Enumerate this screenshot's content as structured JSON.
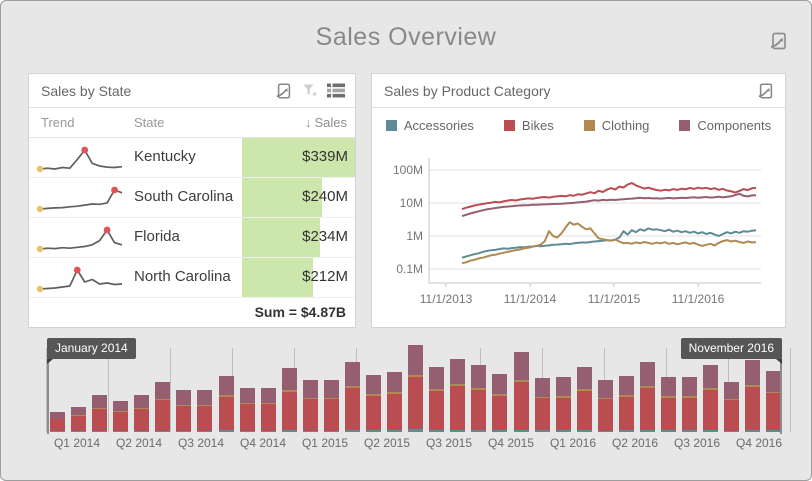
{
  "title": "Sales Overview",
  "panels": {
    "sales_by_state": {
      "title": "Sales by State",
      "columns": {
        "trend": "Trend",
        "state": "State",
        "sales": "Sales"
      },
      "sort_indicator": "↓",
      "rows": [
        {
          "state": "Kentucky",
          "sales": "$339M",
          "bar_pct": 100,
          "trend": [
            3,
            3.2,
            3,
            3.4,
            3.2,
            5.5,
            8,
            4.5,
            3.8,
            3.5,
            3.4,
            3.6
          ]
        },
        {
          "state": "South Carolina",
          "sales": "$240M",
          "bar_pct": 71,
          "trend": [
            2,
            2.1,
            2.2,
            2.25,
            2.4,
            2.5,
            2.7,
            2.9,
            2.85,
            3.1,
            5.4,
            4.9
          ]
        },
        {
          "state": "Florida",
          "sales": "$234M",
          "bar_pct": 69,
          "trend": [
            2,
            2.2,
            2.1,
            2.3,
            2.2,
            2.4,
            2.6,
            3.0,
            4.0,
            6.5,
            3.5,
            3.0
          ]
        },
        {
          "state": "North Carolina",
          "sales": "$212M",
          "bar_pct": 63,
          "trend": [
            2,
            2.1,
            2.2,
            2.4,
            2.6,
            5.8,
            3.4,
            3.9,
            3.0,
            3.2,
            2.9,
            3.0
          ]
        }
      ],
      "footer": "Sum = $4.87B",
      "sparkline_colors": {
        "line": "#5f5f5f",
        "min_point": "#e8c267",
        "max_point": "#e55253"
      }
    },
    "sales_by_category": {
      "title": "Sales by Product Category"
    }
  },
  "chart_data": [
    {
      "type": "line",
      "title": "Sales by Product Category",
      "y_scale": "log",
      "ylim": [
        100000,
        200000000
      ],
      "ytick_labels": [
        "100M",
        "10M",
        "1M",
        "0.1M"
      ],
      "ytick_values": [
        100,
        10,
        1,
        0.1
      ],
      "xtick_labels": [
        "11/1/2013",
        "11/1/2014",
        "11/1/2015",
        "11/1/2016"
      ],
      "legend_position": "top",
      "grid": true,
      "units": "millions USD, monthly-ish samples Jan 2014 - Dec 2016",
      "series": [
        {
          "name": "Accessories",
          "color": "#5f8b95",
          "values": [
            0.22,
            0.24,
            0.26,
            0.28,
            0.3,
            0.33,
            0.35,
            0.37,
            0.38,
            0.4,
            0.42,
            0.41,
            0.43,
            0.44,
            0.46,
            0.45,
            0.47,
            0.48,
            0.5,
            0.49,
            0.51,
            0.52,
            0.54,
            0.55,
            0.56,
            0.58,
            0.57,
            0.6,
            0.62,
            0.64,
            0.63,
            0.66,
            0.68,
            0.7,
            0.72,
            0.75,
            0.73,
            0.78,
            0.9,
            1.4,
            1.1,
            1.5,
            1.3,
            1.6,
            1.45,
            1.7,
            1.55,
            1.6,
            1.5,
            1.4,
            1.55,
            1.35,
            1.45,
            1.3,
            1.4,
            1.25,
            1.35,
            1.2,
            1.3,
            1.15,
            1.25,
            1.1,
            1.0,
            1.15,
            1.3,
            1.2,
            1.35,
            1.25,
            1.4,
            1.35,
            1.45,
            1.5
          ]
        },
        {
          "name": "Bikes",
          "color": "#ba4d51",
          "values": [
            6.5,
            7.2,
            7.8,
            8.4,
            8.9,
            9.3,
            9.8,
            10.2,
            10.8,
            10.4,
            11.2,
            11.8,
            12.3,
            11.9,
            12.8,
            13.2,
            13.8,
            13.4,
            14.2,
            14.8,
            15.2,
            14.6,
            15.4,
            15.9,
            16.4,
            15.8,
            17.2,
            16.6,
            18.4,
            17.8,
            19.6,
            21.2,
            19.8,
            23.5,
            21.6,
            25.4,
            28.2,
            25.6,
            31.5,
            29.4,
            36.0,
            40.5,
            34.2,
            30.6,
            27.4,
            29.2,
            26.5,
            24.8,
            23.6,
            25.2,
            24.1,
            26.3,
            25.0,
            27.2,
            26.0,
            28.4,
            26.8,
            29.0,
            27.6,
            28.8,
            26.4,
            28.0,
            25.2,
            26.8,
            24.0,
            22.4,
            20.8,
            23.2,
            26.4,
            24.6,
            27.8,
            28.6
          ]
        },
        {
          "name": "Clothing",
          "color": "#af8a53",
          "values": [
            0.15,
            0.16,
            0.18,
            0.19,
            0.21,
            0.22,
            0.24,
            0.26,
            0.27,
            0.29,
            0.31,
            0.33,
            0.35,
            0.37,
            0.39,
            0.42,
            0.44,
            0.47,
            0.5,
            0.55,
            0.7,
            1.4,
            1.0,
            0.9,
            1.2,
            1.8,
            2.6,
            2.2,
            2.4,
            1.9,
            1.6,
            1.7,
            1.2,
            0.85,
            0.8,
            0.75,
            0.72,
            0.78,
            0.68,
            0.6,
            0.62,
            0.58,
            0.64,
            0.6,
            0.66,
            0.62,
            0.58,
            0.63,
            0.6,
            0.65,
            0.58,
            0.62,
            0.56,
            0.6,
            0.64,
            0.58,
            0.62,
            0.55,
            0.5,
            0.54,
            0.58,
            0.52,
            0.62,
            0.7,
            0.75,
            0.68,
            0.72,
            0.66,
            0.62,
            0.68,
            0.64,
            0.65
          ]
        },
        {
          "name": "Components",
          "color": "#955f71",
          "values": [
            4.0,
            4.4,
            4.8,
            5.2,
            5.6,
            6.0,
            6.4,
            6.7,
            7.0,
            7.3,
            7.6,
            7.8,
            8.0,
            8.2,
            8.4,
            8.5,
            8.6,
            8.8,
            8.9,
            9.0,
            9.1,
            9.2,
            9.3,
            9.4,
            9.5,
            9.7,
            9.9,
            10.1,
            10.4,
            10.7,
            11.0,
            11.6,
            12.2,
            11.8,
            12.4,
            12.1,
            12.6,
            12.3,
            12.8,
            13.0,
            13.3,
            13.6,
            14.0,
            14.4,
            13.9,
            14.2,
            13.8,
            14.0,
            13.6,
            13.9,
            14.3,
            13.8,
            14.1,
            14.5,
            14.2,
            14.6,
            15.0,
            14.4,
            14.8,
            15.2,
            14.6,
            15.0,
            15.5,
            14.8,
            15.4,
            16.0,
            17.5,
            19.0,
            16.5,
            15.8,
            17.0,
            17.2
          ]
        }
      ]
    },
    {
      "type": "stacked-bar",
      "title": "Range selector: monthly sales Jan 2014 - Nov 2016",
      "categories": [
        "Q1 2014",
        "Q2 2014",
        "Q3 2014",
        "Q4 2014",
        "Q1 2015",
        "Q2 2015",
        "Q3 2015",
        "Q4 2015",
        "Q1 2016",
        "Q2 2016",
        "Q3 2016",
        "Q4 2016"
      ],
      "bars_per_category": 3,
      "units": "millions USD per month",
      "series": [
        {
          "name": "Accessories",
          "color": "#5f8b95",
          "values": [
            0.9,
            1.1,
            1.7,
            1.4,
            1.7,
            2.3,
            1.9,
            1.9,
            2.5,
            2.0,
            2.0,
            2.9,
            2.3,
            2.3,
            3.1,
            2.6,
            2.7,
            3.9,
            2.9,
            3.3,
            3.0,
            2.6,
            3.6,
            2.4,
            2.5,
            2.9,
            2.3,
            2.5,
            3.2,
            2.5,
            2.5,
            3.0,
            2.3,
            3.2,
            2.7
          ]
        },
        {
          "name": "Bikes",
          "color": "#ba4d51",
          "values": [
            18,
            23,
            33,
            28,
            33,
            45,
            37,
            37,
            50,
            40,
            40,
            57,
            47,
            47,
            62,
            51,
            54,
            78,
            59,
            65,
            60,
            52,
            71,
            48,
            49,
            59,
            47,
            50,
            63,
            49,
            49,
            60,
            45,
            64,
            55
          ]
        },
        {
          "name": "Clothing",
          "color": "#af8a53",
          "values": [
            0.9,
            1.1,
            1.7,
            1.4,
            1.7,
            2.3,
            1.9,
            1.9,
            2.5,
            2.0,
            2.0,
            2.9,
            2.3,
            2.3,
            3.1,
            2.6,
            2.7,
            3.9,
            2.9,
            3.3,
            3.0,
            2.6,
            3.6,
            2.4,
            2.5,
            2.9,
            2.3,
            2.5,
            3.2,
            2.5,
            2.5,
            3.0,
            2.3,
            3.2,
            2.7
          ]
        },
        {
          "name": "Components",
          "color": "#955f71",
          "values": [
            10.2,
            12.8,
            18.6,
            15.2,
            18.6,
            25.4,
            21.2,
            21.2,
            29,
            22,
            22,
            32.2,
            26.4,
            26.4,
            35.8,
            28.8,
            30.6,
            44.2,
            33.2,
            37.4,
            34,
            29.8,
            40.8,
            27.2,
            28,
            33.2,
            26.4,
            29,
            35.6,
            28,
            28,
            34,
            25.4,
            36.6,
            30.6
          ]
        }
      ]
    }
  ],
  "range_selector": {
    "start_label": "January 2014",
    "end_label": "November 2016"
  },
  "colors": {
    "background": "#e7e7e7",
    "panel": "#ffffff",
    "green_databar": "#cde6ab",
    "badge": "#565656"
  }
}
